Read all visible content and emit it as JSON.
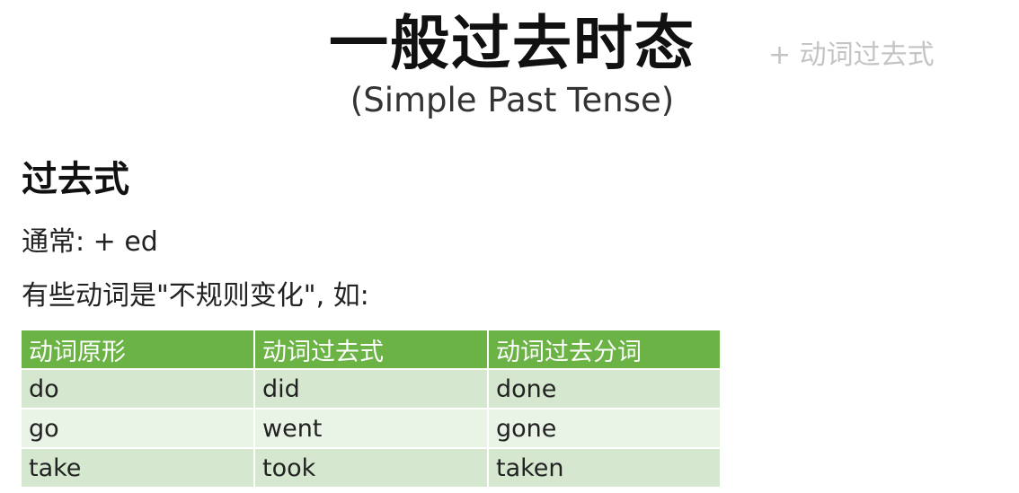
{
  "slide": {
    "title": "一般过去时态",
    "subtitle": "(Simple Past Tense)",
    "side_note": "+ 动词过去式"
  },
  "section": {
    "heading": "过去式",
    "rule_regular": "通常: + ed",
    "rule_irregular": "有些动词是\"不规则变化\", 如:"
  },
  "table": {
    "headers": [
      "动词原形",
      "动词过去式",
      "动词过去分词"
    ],
    "rows": [
      [
        "do",
        "did",
        "done"
      ],
      [
        "go",
        "went",
        "gone"
      ],
      [
        "take",
        "took",
        "taken"
      ]
    ]
  },
  "colors": {
    "header_green": "#6ab344",
    "row_dark": "#d5e8cf",
    "row_light": "#eaf4e6",
    "side_note_gray": "#c4c4c4"
  }
}
